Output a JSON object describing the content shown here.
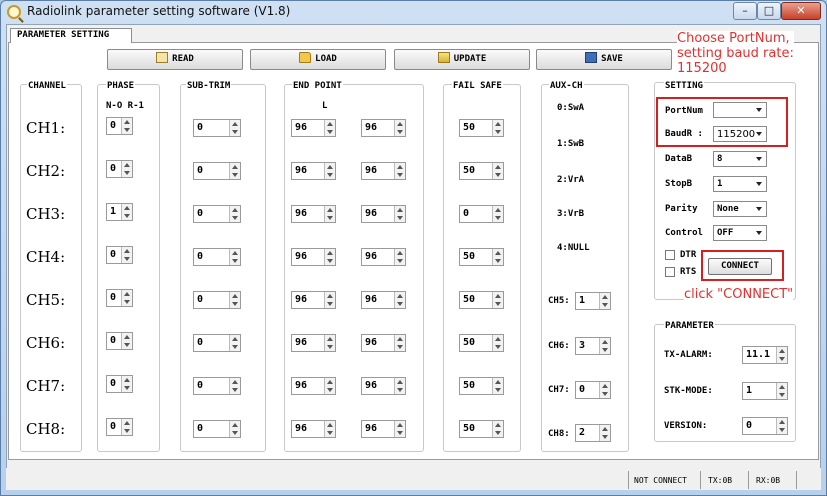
{
  "window": {
    "title": "Radiolink parameter setting software (V1.8)",
    "controls": {
      "minimize": "–",
      "maximize": "□",
      "close": "✕"
    }
  },
  "tab": {
    "label": "PARAMETER  SETTING"
  },
  "toolbar": {
    "read": "READ",
    "load": "LOAD",
    "update": "UPDATE",
    "save": "SAVE"
  },
  "headers": {
    "channel": "CHANNEL",
    "phase": "PHASE",
    "phase_sub": "N-O  R-1",
    "sub_trim": "SUB-TRIM",
    "end_point": "END POINT",
    "end_point_sub": "L",
    "fail_safe": "FAIL SAFE",
    "aux_ch": "AUX-CH",
    "setting": "SETTING",
    "parameter": "PARAMETER"
  },
  "channels": [
    {
      "name": "CH1:",
      "phase": "0",
      "sub_trim": "0",
      "ep_l": "96",
      "ep_r": "96",
      "fail_safe": "50"
    },
    {
      "name": "CH2:",
      "phase": "0",
      "sub_trim": "0",
      "ep_l": "96",
      "ep_r": "96",
      "fail_safe": "50"
    },
    {
      "name": "CH3:",
      "phase": "1",
      "sub_trim": "0",
      "ep_l": "96",
      "ep_r": "96",
      "fail_safe": "0"
    },
    {
      "name": "CH4:",
      "phase": "0",
      "sub_trim": "0",
      "ep_l": "96",
      "ep_r": "96",
      "fail_safe": "50"
    },
    {
      "name": "CH5:",
      "phase": "0",
      "sub_trim": "0",
      "ep_l": "96",
      "ep_r": "96",
      "fail_safe": "50"
    },
    {
      "name": "CH6:",
      "phase": "0",
      "sub_trim": "0",
      "ep_l": "96",
      "ep_r": "96",
      "fail_safe": "50"
    },
    {
      "name": "CH7:",
      "phase": "0",
      "sub_trim": "0",
      "ep_l": "96",
      "ep_r": "96",
      "fail_safe": "50"
    },
    {
      "name": "CH8:",
      "phase": "0",
      "sub_trim": "0",
      "ep_l": "96",
      "ep_r": "96",
      "fail_safe": "50"
    }
  ],
  "aux": {
    "fixed": [
      "0:SwA",
      "1:SwB",
      "2:VrA",
      "3:VrB",
      "4:NULL"
    ],
    "assign": [
      {
        "label": "CH5:",
        "value": "1"
      },
      {
        "label": "CH6:",
        "value": "3"
      },
      {
        "label": "CH7:",
        "value": "0"
      },
      {
        "label": "CH8:",
        "value": "2"
      }
    ]
  },
  "setting": {
    "portnum_label": "PortNum",
    "portnum_value": "",
    "baud_label": "BaudR :",
    "baud_value": "115200",
    "datab_label": "DataB",
    "datab_value": "8",
    "stopb_label": "StopB",
    "stopb_value": "1",
    "parity_label": "Parity",
    "parity_value": "None",
    "control_label": "Control",
    "control_value": "OFF",
    "dtr_label": "DTR",
    "rts_label": "RTS",
    "connect": "CONNECT"
  },
  "parameter": {
    "tx_alarm_label": "TX-ALARM:",
    "tx_alarm_value": "11.1",
    "stk_mode_label": "STK-MODE:",
    "stk_mode_value": "1",
    "version_label": "VERSION:",
    "version_value": "0"
  },
  "annotations": {
    "choose_line1": "Choose PortNum,",
    "choose_line2": "setting baud rate:",
    "choose_line3": "115200",
    "click": "click \"CONNECT\"",
    "color": "#e23030"
  },
  "status": {
    "connection": "NOT CONNECT",
    "tx": "TX:0B",
    "rx": "RX:0B"
  }
}
